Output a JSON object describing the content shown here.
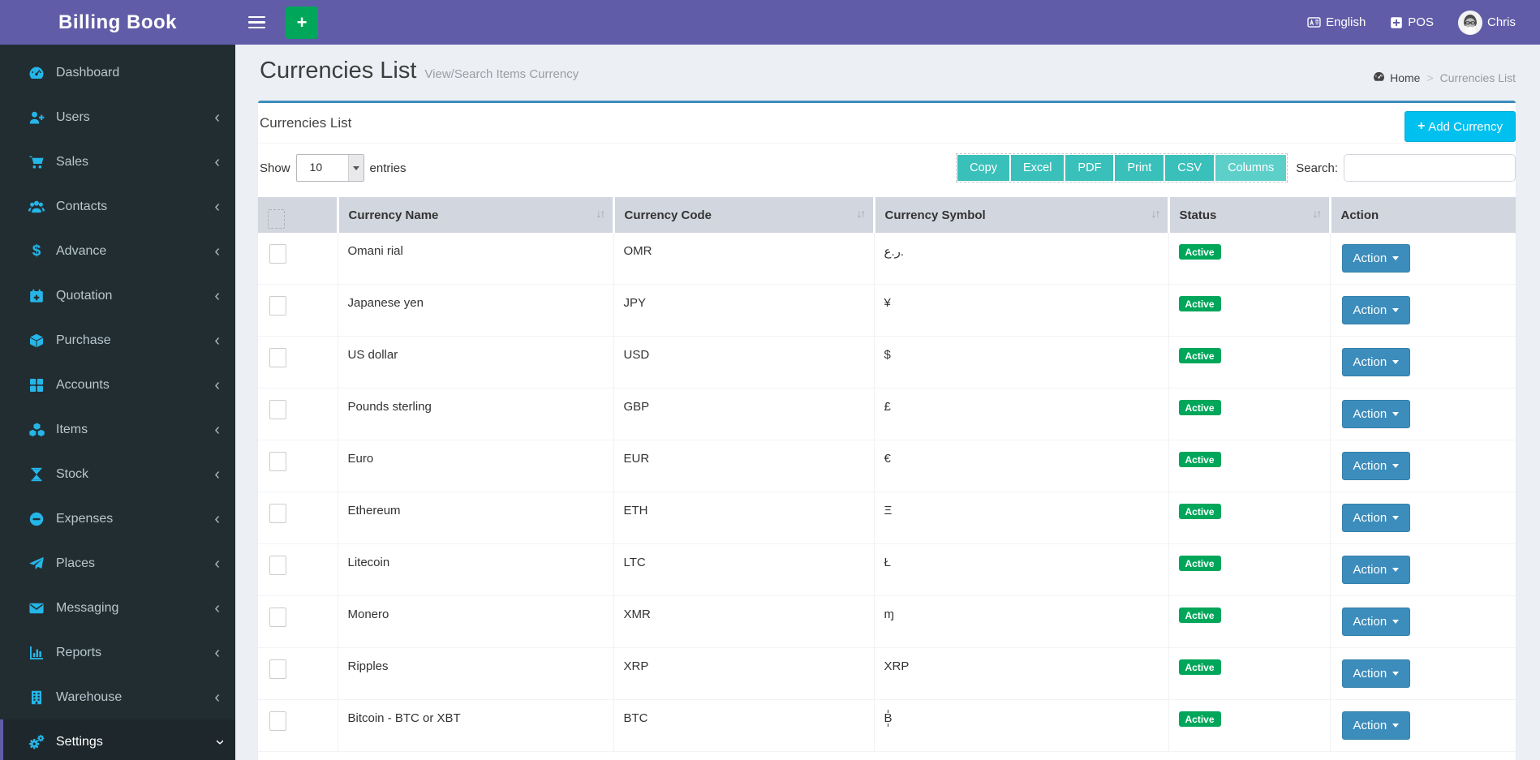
{
  "app": {
    "brand": "Billing Book"
  },
  "navbar": {
    "language_label": "English",
    "pos_label": "POS",
    "user_name": "Chris"
  },
  "sidebar": {
    "items": [
      {
        "label": "Dashboard",
        "icon": "dashboard-icon",
        "expandable": false,
        "active": false
      },
      {
        "label": "Users",
        "icon": "user-plus-icon",
        "expandable": true,
        "active": false
      },
      {
        "label": "Sales",
        "icon": "cart-icon",
        "expandable": true,
        "active": false
      },
      {
        "label": "Contacts",
        "icon": "users-icon",
        "expandable": true,
        "active": false
      },
      {
        "label": "Advance",
        "icon": "dollar-icon",
        "expandable": true,
        "active": false
      },
      {
        "label": "Quotation",
        "icon": "calendar-plus-icon",
        "expandable": true,
        "active": false
      },
      {
        "label": "Purchase",
        "icon": "cube-icon",
        "expandable": true,
        "active": false
      },
      {
        "label": "Accounts",
        "icon": "grid-icon",
        "expandable": true,
        "active": false
      },
      {
        "label": "Items",
        "icon": "cubes-icon",
        "expandable": true,
        "active": false
      },
      {
        "label": "Stock",
        "icon": "hourglass-icon",
        "expandable": true,
        "active": false
      },
      {
        "label": "Expenses",
        "icon": "minus-circle-icon",
        "expandable": true,
        "active": false
      },
      {
        "label": "Places",
        "icon": "paper-plane-icon",
        "expandable": true,
        "active": false
      },
      {
        "label": "Messaging",
        "icon": "envelope-icon",
        "expandable": true,
        "active": false
      },
      {
        "label": "Reports",
        "icon": "bar-chart-icon",
        "expandable": true,
        "active": false
      },
      {
        "label": "Warehouse",
        "icon": "building-icon",
        "expandable": true,
        "active": false
      },
      {
        "label": "Settings",
        "icon": "gears-icon",
        "expandable": true,
        "active": true
      }
    ]
  },
  "page_header": {
    "title": "Currencies List",
    "subtitle": "View/Search Items Currency",
    "breadcrumb": {
      "home_label": "Home",
      "separator": ">",
      "current": "Currencies List"
    }
  },
  "box": {
    "heading": "Currencies List",
    "add_button_label": "Add Currency",
    "length_menu": {
      "prefix": "Show",
      "selected": "10",
      "suffix": "entries"
    },
    "export_buttons": [
      {
        "label": "Copy",
        "active": false
      },
      {
        "label": "Excel",
        "active": false
      },
      {
        "label": "PDF",
        "active": false
      },
      {
        "label": "Print",
        "active": false
      },
      {
        "label": "CSV",
        "active": false
      },
      {
        "label": "Columns",
        "active": true
      }
    ],
    "search_label": "Search:",
    "search_value": ""
  },
  "table": {
    "columns": [
      {
        "label": "",
        "type": "checkbox",
        "sortable": false
      },
      {
        "label": "Currency Name",
        "sortable": true
      },
      {
        "label": "Currency Code",
        "sortable": true
      },
      {
        "label": "Currency Symbol",
        "sortable": true
      },
      {
        "label": "Status",
        "sortable": true
      },
      {
        "label": "Action",
        "sortable": false
      }
    ],
    "rows": [
      {
        "name": "Omani rial",
        "code": "OMR",
        "symbol": "ر.ع.",
        "status": "Active",
        "action": "Action"
      },
      {
        "name": "Japanese yen",
        "code": "JPY",
        "symbol": "¥",
        "status": "Active",
        "action": "Action"
      },
      {
        "name": "US dollar",
        "code": "USD",
        "symbol": "$",
        "status": "Active",
        "action": "Action"
      },
      {
        "name": "Pounds sterling",
        "code": "GBP",
        "symbol": "£",
        "status": "Active",
        "action": "Action"
      },
      {
        "name": "Euro",
        "code": "EUR",
        "symbol": "€",
        "status": "Active",
        "action": "Action"
      },
      {
        "name": "Ethereum",
        "code": "ETH",
        "symbol": "Ξ",
        "status": "Active",
        "action": "Action"
      },
      {
        "name": "Litecoin",
        "code": "LTC",
        "symbol": "Ł",
        "status": "Active",
        "action": "Action"
      },
      {
        "name": "Monero",
        "code": "XMR",
        "symbol": "ɱ",
        "status": "Active",
        "action": "Action"
      },
      {
        "name": "Ripples",
        "code": "XRP",
        "symbol": "XRP",
        "status": "Active",
        "action": "Action"
      },
      {
        "name": "Bitcoin - BTC or XBT",
        "code": "BTC",
        "symbol": "₿",
        "status": "Active",
        "action": "Action"
      }
    ]
  },
  "colors": {
    "navbar": "#605ca8",
    "sidebar": "#222d32",
    "sidebar_icon": "#25b6e8",
    "box_top_border": "#3c8dbc",
    "add_button": "#00c0ef",
    "export_button": "#3ac0ba",
    "export_button_active": "#5ccfc9",
    "status_badge": "#00a65a",
    "action_button": "#3c8dbc",
    "table_header_bg": "#d2d6de",
    "quick_add_button": "#00a65a"
  }
}
